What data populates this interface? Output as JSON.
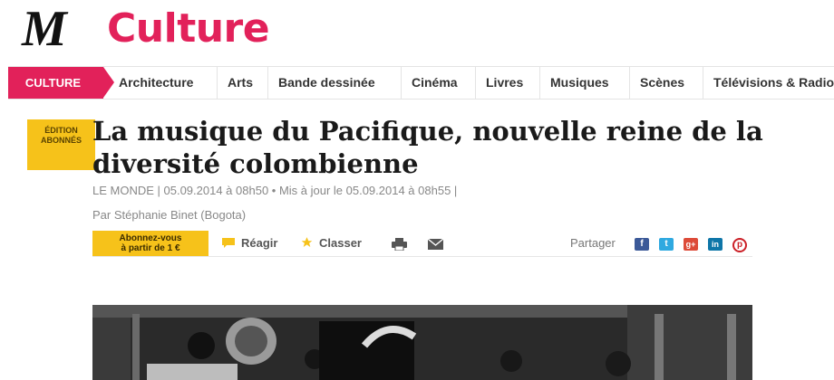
{
  "logo": {
    "mark": "M",
    "section": "Culture"
  },
  "nav": {
    "active": "CULTURE",
    "items": [
      "Architecture",
      "Arts",
      "Bande dessinée",
      "Cinéma",
      "Livres",
      "Musiques",
      "Scènes",
      "Télévisions & Radio"
    ]
  },
  "badge": {
    "line1": "ÉDITION",
    "line2": "ABONNÉS"
  },
  "article": {
    "title": "La musique du Pacifique, nouvelle reine de la diversité colombienne",
    "meta": "LE MONDE | 05.09.2014 à 08h50 • Mis à jour le 05.09.2014 à 08h55 |",
    "author": "Par Stéphanie Binet (Bogota)"
  },
  "toolbar": {
    "subscribe_line1": "Abonnez-vous",
    "subscribe_line2": "à partir de 1 €",
    "react": "Réagir",
    "save": "Classer",
    "share_label": "Partager",
    "share_icons": [
      "facebook-icon",
      "twitter-icon",
      "googleplus-icon",
      "linkedin-icon",
      "pinterest-icon"
    ]
  },
  "colors": {
    "brand": "#e2215a",
    "badge": "#f6c21a"
  }
}
